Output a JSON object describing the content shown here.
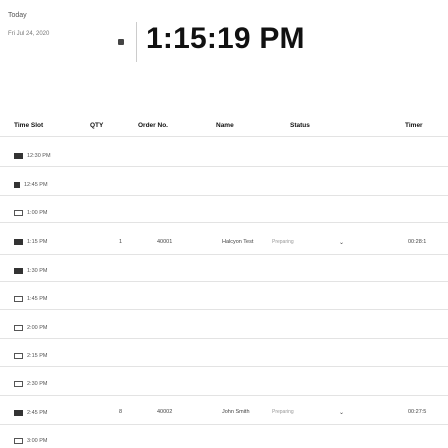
{
  "header": {
    "today_label": "Today",
    "date": "Fri Jul 24, 2020",
    "clock": "1:15:19 PM"
  },
  "columns": {
    "time_slot": "Time Slot",
    "qty": "QTY",
    "order_no": "Order No.",
    "name": "Name",
    "status": "Status",
    "timer": "Timer"
  },
  "slots": [
    {
      "time": "12:30 PM",
      "state": "filled"
    },
    {
      "time": "12:45 PM",
      "state": "half"
    },
    {
      "time": "1:00 PM",
      "state": "empty"
    },
    {
      "time": "1:15 PM",
      "state": "filled"
    },
    {
      "time": "1:30 PM",
      "state": "filled"
    },
    {
      "time": "1:45 PM",
      "state": "empty"
    },
    {
      "time": "2:00 PM",
      "state": "empty"
    },
    {
      "time": "2:15 PM",
      "state": "empty"
    },
    {
      "time": "2:30 PM",
      "state": "empty"
    },
    {
      "time": "2:45 PM",
      "state": "filled"
    },
    {
      "time": "3:00 PM",
      "state": "empty"
    }
  ],
  "orders": [
    {
      "qty": "1",
      "order_no": "40001",
      "name": "Halcyon Test",
      "status": "Preparing",
      "timer": "00:28:1"
    },
    {
      "qty": "8",
      "order_no": "40002",
      "name": "John Smith",
      "status": "Preparing",
      "timer": "00:27:5"
    }
  ]
}
